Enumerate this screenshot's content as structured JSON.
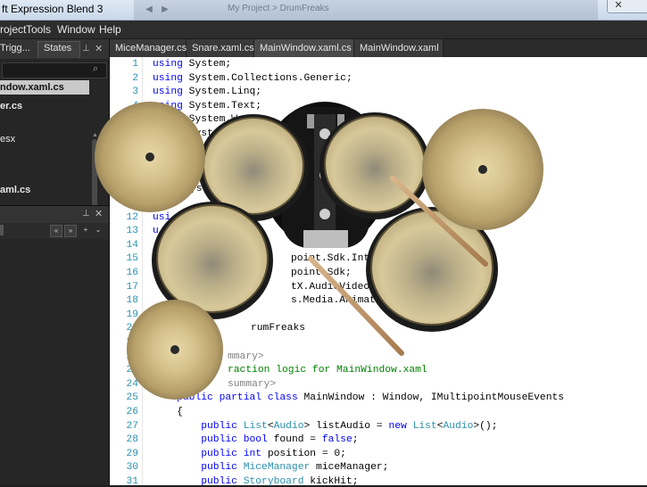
{
  "window": {
    "title": "ft Expression Blend 3"
  },
  "background_window": {
    "text": "My Project  >  DrumFreaks"
  },
  "window_controls": {
    "close": "✕"
  },
  "menu": [
    "roject",
    "Tools",
    "Window",
    "Help"
  ],
  "left_panel": {
    "tabs": [
      "Trigg...",
      "States"
    ],
    "pin": "📌",
    "close": "✕",
    "search_placeholder": "",
    "project_items": [
      {
        "label": "ndow.xaml.cs",
        "selected": true
      },
      {
        "label": "er.cs",
        "selected": false
      },
      {
        "label": "esx",
        "selected": false
      },
      {
        "label": "aml.cs",
        "selected": false
      }
    ],
    "panel2_tools": [
      "«",
      "+",
      "⌄"
    ]
  },
  "document_tabs": [
    {
      "label": "MiceManager.cs",
      "active": false
    },
    {
      "label": "Snare.xaml.cs",
      "active": false
    },
    {
      "label": "MainWindow.xaml.cs",
      "active": true,
      "close": "×"
    },
    {
      "label": "MainWindow.xaml",
      "active": false
    }
  ],
  "code_lines": [
    {
      "n": "1",
      "text": "using System;"
    },
    {
      "n": "2",
      "text": "using System.Collections.Generic;"
    },
    {
      "n": "3",
      "text": "using System.Linq;"
    },
    {
      "n": "4",
      "text": "using System.Text;"
    },
    {
      "n": "5",
      "text": "using System.W"
    },
    {
      "n": "6",
      "text": "using Syste"
    },
    {
      "n": "7",
      "text": ""
    },
    {
      "n": "8",
      "text": ""
    },
    {
      "n": "9",
      "text": ""
    },
    {
      "n": "10",
      "text": "ys"
    },
    {
      "n": "11",
      "text": ""
    },
    {
      "n": "12",
      "text": "usi"
    },
    {
      "n": "13",
      "text": "u"
    },
    {
      "n": "14",
      "text": ""
    },
    {
      "n": "15",
      "text": "point.Sdk.Intero"
    },
    {
      "n": "16",
      "text": "point.Sdk;"
    },
    {
      "n": "17",
      "text": "tX.AudioVideoPla"
    },
    {
      "n": "18",
      "text": "s.Media.Animation;"
    },
    {
      "n": "19",
      "text": ""
    },
    {
      "n": "20",
      "text": "rumFreaks"
    },
    {
      "n": "21",
      "text": ""
    },
    {
      "n": "22",
      "text": "mmary>"
    },
    {
      "n": "23",
      "text": "ractio"
    },
    {
      "n": "24",
      "text": "summary>"
    },
    {
      "n": "25",
      "text": "public partial class MainWindow : Window, IMultipointMouseEvents"
    },
    {
      "n": "26",
      "text": "{"
    },
    {
      "n": "27",
      "text": "public List<Audio> listAudio = new List<Audio>();"
    },
    {
      "n": "28",
      "text": "public bool found = false;"
    },
    {
      "n": "29",
      "text": "public int position = 0;"
    },
    {
      "n": "30",
      "text": "public MiceManager miceManager;"
    },
    {
      "n": "31",
      "text": "public Storyboard kickHit;"
    }
  ],
  "code_tokens": {
    "l1_kw": "using",
    "l1_rest": " System;",
    "l2_kw": "using",
    "l2_rest": " System.Collections.Generic;",
    "l3_kw": "using",
    "l3_rest": " System.Linq;",
    "l4_kw": "using",
    "l4_rest": " System.Text;",
    "l5_kw": "using",
    "l5_rest": " System.W",
    "l6_kw": "using",
    "l6_rest": " Syste",
    "l10": "ys",
    "l12": "usi",
    "l13": "u",
    "l15": "point.Sdk.Intero",
    "l16": "point.Sdk;",
    "l17": "tX.AudioVideoPla",
    "l18": "s.Media.Animation;",
    "l20": "rumFreaks",
    "l22": "mmary>",
    "l23": "raction logic for MainWindow.xaml",
    "l24": "summary>",
    "l25_kw1": "public",
    "l25_kw2": "partial",
    "l25_kw3": "class",
    "l25_rest": " MainWindow : Window, IMultipointMouseEvents",
    "l26": "{",
    "l27_kw": "public",
    "l27_ty": "List",
    "l27_a": "<",
    "l27_ty2": "Audio",
    "l27_b": "> listAudio = ",
    "l27_kw2": "new",
    "l27_ty3": "List",
    "l27_c": "<",
    "l27_ty4": "Audio",
    "l27_d": ">();",
    "l28_kw": "public",
    "l28_kw2": "bool",
    "l28_a": " found = ",
    "l28_kw3": "false",
    "l28_b": ";",
    "l29_kw": "public",
    "l29_kw2": "int",
    "l29_a": " position = 0;",
    "l30_kw": "public",
    "l30_ty": "MiceManager",
    "l30_a": " miceManager;",
    "l31_kw": "public",
    "l31_ty": "Storyboard",
    "l31_a": " kickHit;"
  },
  "colors": {
    "keyword": "#0000ff",
    "type": "#2b91af",
    "comment": "#008000",
    "line_number": "#2b91af"
  }
}
